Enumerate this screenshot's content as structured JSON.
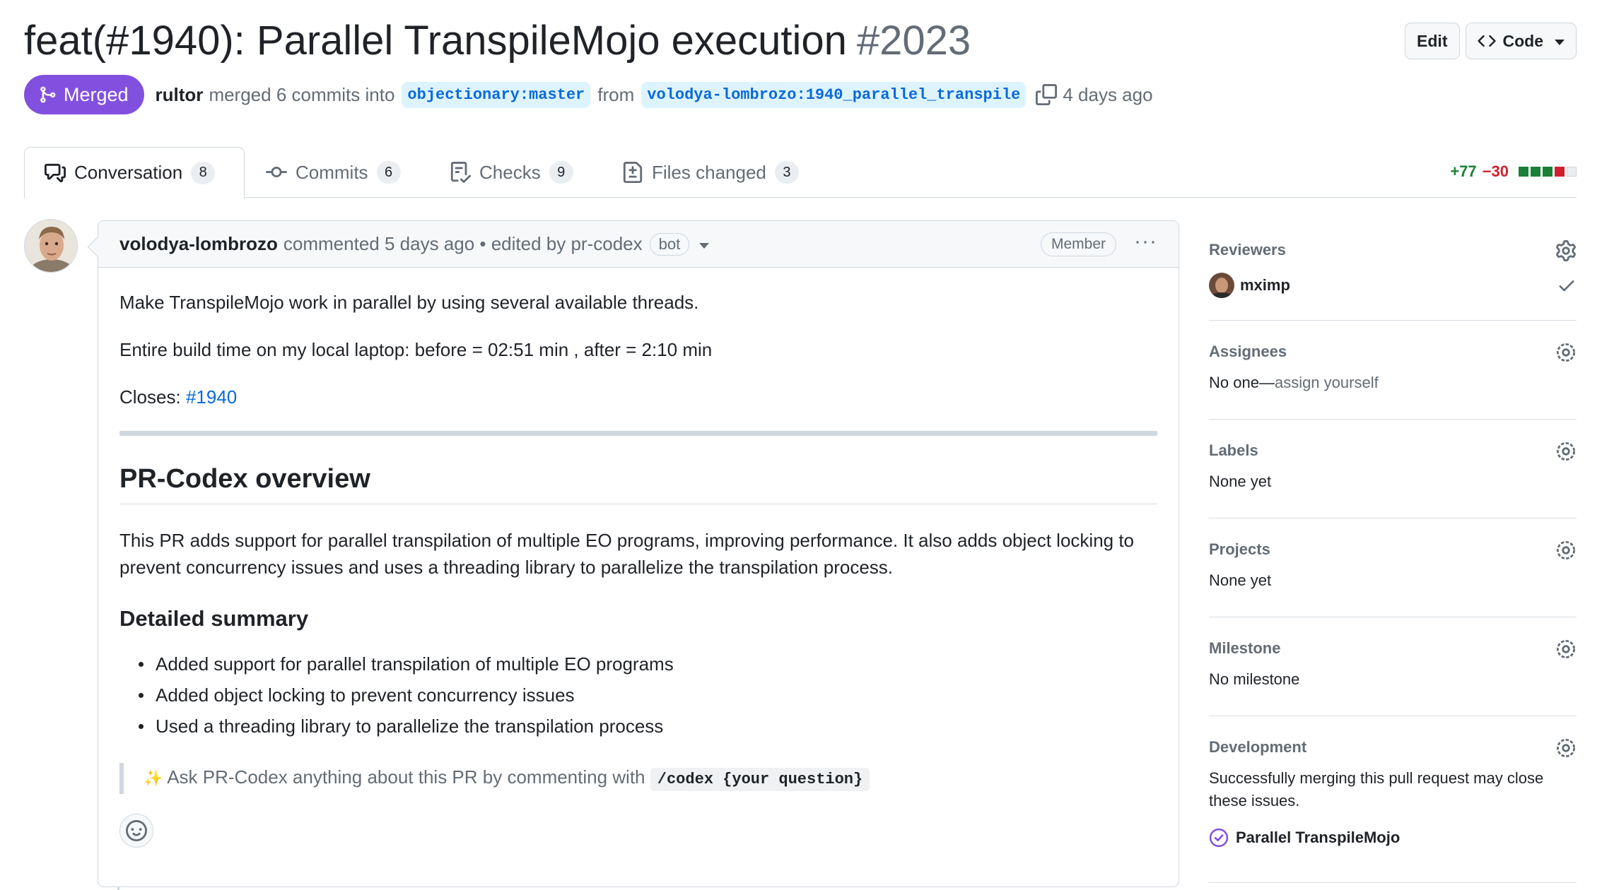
{
  "pr": {
    "title": "feat(#1940): Parallel TranspileMojo execution",
    "number": "#2023",
    "state": "Merged",
    "merger": "rultor",
    "merge_text": "merged 6 commits into",
    "base_branch": "objectionary:master",
    "from_text": "from",
    "head_branch": "volodya-lombrozo:1940_parallel_transpile",
    "time": "4 days ago"
  },
  "header_actions": {
    "edit": "Edit",
    "code": "Code"
  },
  "tabs": [
    {
      "label": "Conversation",
      "count": "8",
      "icon": "comment-discussion-icon"
    },
    {
      "label": "Commits",
      "count": "6",
      "icon": "git-commit-icon"
    },
    {
      "label": "Checks",
      "count": "9",
      "icon": "checklist-icon"
    },
    {
      "label": "Files changed",
      "count": "3",
      "icon": "file-diff-icon"
    }
  ],
  "diffstat": {
    "additions": "+77",
    "deletions": "−30",
    "bar_colors": [
      "#1a7f37",
      "#1a7f37",
      "#1a7f37",
      "#cf222e",
      "#d0d7de"
    ]
  },
  "comment": {
    "author": "volodya-lombrozo",
    "action": "commented 5 days ago • edited by pr-codex",
    "bot": "bot",
    "role": "Member",
    "p1": "Make TranspileMojo work in parallel by using several available threads.",
    "p2": "Entire build time on my local laptop: before = 02:51 min , after = 2:10 min",
    "closes_label": "Closes:",
    "closes_link": "#1940",
    "overview_heading": "PR-Codex overview",
    "overview_text": "This PR adds support for parallel transpilation of multiple EO programs, improving performance. It also adds object locking to prevent concurrency issues and uses a threading library to parallelize the transpilation process.",
    "summary_heading": "Detailed summary",
    "summary_items": [
      "Added support for parallel transpilation of multiple EO programs",
      "Added object locking to prevent concurrency issues",
      "Used a threading library to parallelize the transpilation process"
    ],
    "quote_emoji": "✨",
    "quote_text": "Ask PR-Codex anything about this PR by commenting with",
    "quote_code": "/codex {your question}"
  },
  "sidebar": {
    "reviewers": {
      "title": "Reviewers",
      "name": "mximp"
    },
    "assignees": {
      "title": "Assignees",
      "value": "No one—",
      "action": "assign yourself"
    },
    "labels": {
      "title": "Labels",
      "value": "None yet"
    },
    "projects": {
      "title": "Projects",
      "value": "None yet"
    },
    "milestone": {
      "title": "Milestone",
      "value": "No milestone"
    },
    "development": {
      "title": "Development",
      "value": "Successfully merging this pull request may close these issues.",
      "issue": "Parallel TranspileMojo"
    }
  },
  "colors": {
    "merged": "#8250df",
    "link": "#0969da",
    "add": "#1a7f37",
    "delete": "#cf222e"
  }
}
